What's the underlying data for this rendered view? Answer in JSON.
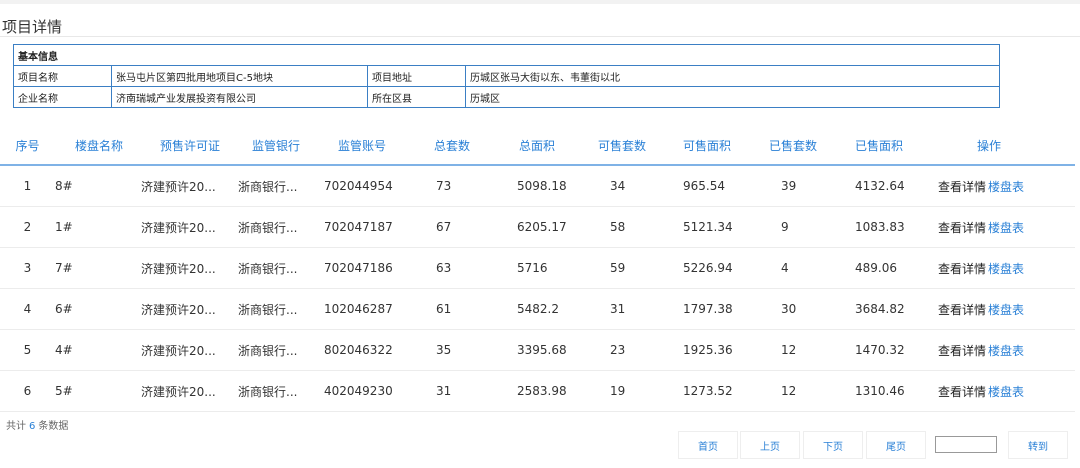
{
  "page": {
    "title": "项目详情"
  },
  "basic_info": {
    "header": "基本信息",
    "project_name_label": "项目名称",
    "project_name": "张马屯片区第四批用地项目C-5地块",
    "project_address_label": "项目地址",
    "project_address": "历城区张马大街以东、韦董街以北",
    "company_label": "企业名称",
    "company": "济南瑞城产业发展投资有限公司",
    "district_label": "所在区县",
    "district": "历城区"
  },
  "table": {
    "columns": [
      "序号",
      "楼盘名称",
      "预售许可证",
      "监管银行",
      "监管账号",
      "总套数",
      "总面积",
      "可售套数",
      "可售面积",
      "已售套数",
      "已售面积",
      "操作"
    ],
    "rows": [
      [
        "1",
        "8#",
        "济建预许20...",
        "浙商银行...",
        "702044954",
        "73",
        "5098.18",
        "34",
        "965.54",
        "39",
        "4132.64"
      ],
      [
        "2",
        "1#",
        "济建预许20...",
        "浙商银行...",
        "702047187",
        "67",
        "6205.17",
        "58",
        "5121.34",
        "9",
        "1083.83"
      ],
      [
        "3",
        "7#",
        "济建预许20...",
        "浙商银行...",
        "702047186",
        "63",
        "5716",
        "59",
        "5226.94",
        "4",
        "489.06"
      ],
      [
        "4",
        "6#",
        "济建预许20...",
        "浙商银行...",
        "102046287",
        "61",
        "5482.2",
        "31",
        "1797.38",
        "30",
        "3684.82"
      ],
      [
        "5",
        "4#",
        "济建预许20...",
        "浙商银行...",
        "802046322",
        "35",
        "3395.68",
        "23",
        "1925.36",
        "12",
        "1470.32"
      ],
      [
        "6",
        "5#",
        "济建预许20...",
        "浙商银行...",
        "402049230",
        "31",
        "2583.98",
        "19",
        "1273.52",
        "12",
        "1310.46"
      ]
    ],
    "action_detail": "查看详情",
    "action_table": "楼盘表"
  },
  "summary": {
    "prefix": "共计",
    "count": "6",
    "suffix": "条数据"
  },
  "pagination": {
    "first": "首页",
    "prev": "上页",
    "next": "下页",
    "last": "尾页",
    "page_input": "",
    "goto": "转到"
  }
}
